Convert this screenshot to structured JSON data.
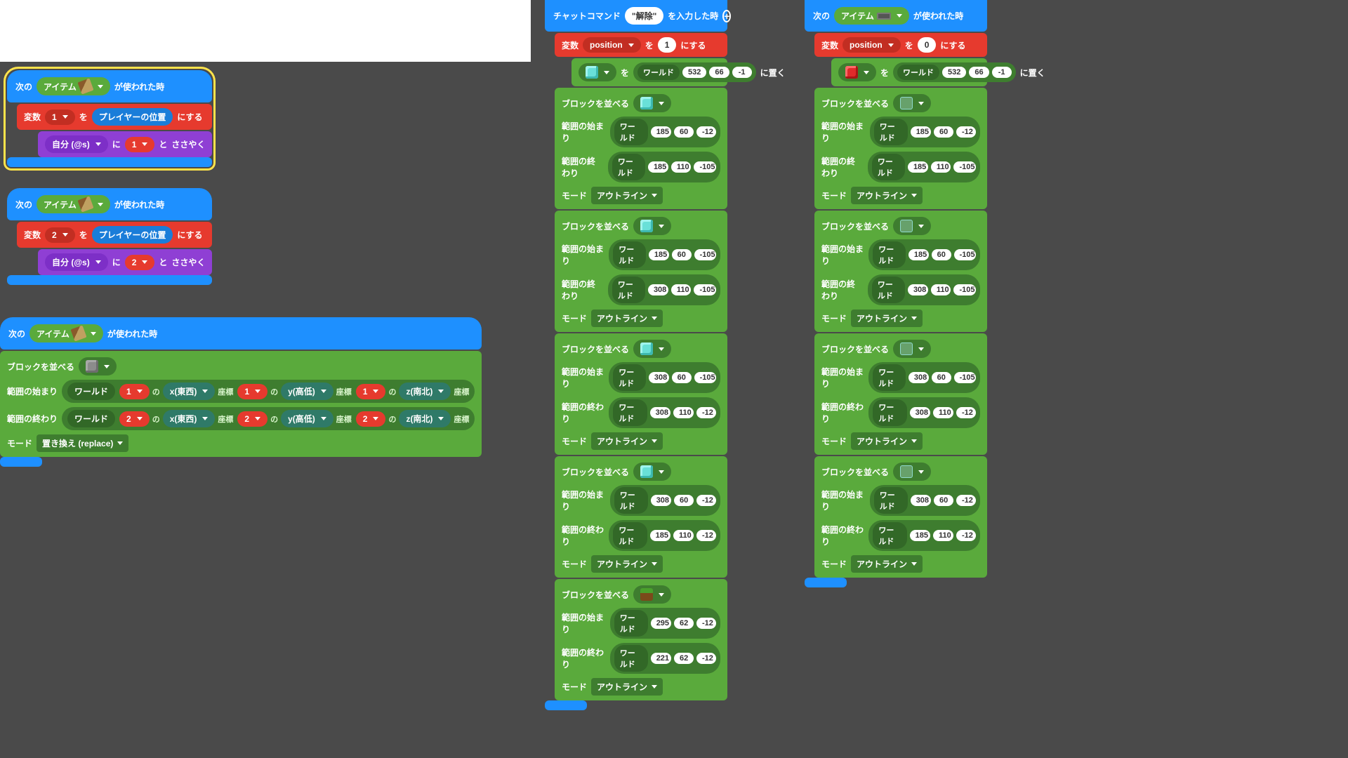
{
  "common": {
    "next": "次の",
    "item": "アイテム",
    "whenUsed": "が使われた時",
    "var": "変数",
    "to": "を",
    "set": "にする",
    "playerPos": "プレイヤーの位置",
    "self": "自分 (@s)",
    "ni": "に",
    "and": "と",
    "whisper": "ささやく",
    "place": "に置く",
    "fill": "ブロックを並べる",
    "from": "範囲の始まり",
    "toEnd": "範囲の終わり",
    "world": "ワールド",
    "mode": "モード",
    "outline": "アウトライン",
    "replace": "置き換え (replace)",
    "no": "の",
    "xLabel": "x(東西)",
    "yLabel": "y(高低)",
    "zLabel": "z(南北)",
    "coord": "座標",
    "chatCmd": "チャットコマンド",
    "chatVal": "\"解除\"",
    "chatSuffix": "を入力した時",
    "position": "position"
  },
  "nums": {
    "one": "1",
    "two": "2",
    "zero": "0"
  },
  "posA": [
    "532",
    "66",
    "-1"
  ],
  "col2": {
    "fills": [
      {
        "ico": "ico-diam",
        "from": [
          "185",
          "60",
          "-12"
        ],
        "to": [
          "185",
          "110",
          "-105"
        ],
        "mode": "outline"
      },
      {
        "ico": "ico-diam",
        "from": [
          "185",
          "60",
          "-105"
        ],
        "to": [
          "308",
          "110",
          "-105"
        ],
        "mode": "outline"
      },
      {
        "ico": "ico-diam",
        "from": [
          "308",
          "60",
          "-105"
        ],
        "to": [
          "308",
          "110",
          "-12"
        ],
        "mode": "outline"
      },
      {
        "ico": "ico-diam",
        "from": [
          "308",
          "60",
          "-12"
        ],
        "to": [
          "185",
          "110",
          "-12"
        ],
        "mode": "outline"
      },
      {
        "ico": "ico-grass",
        "from": [
          "295",
          "62",
          "-12"
        ],
        "to": [
          "221",
          "62",
          "-12"
        ],
        "mode": "outline"
      }
    ]
  },
  "col3": {
    "fills": [
      {
        "ico": "ico-glass",
        "from": [
          "185",
          "60",
          "-12"
        ],
        "to": [
          "185",
          "110",
          "-105"
        ],
        "mode": "outline"
      },
      {
        "ico": "ico-glass",
        "from": [
          "185",
          "60",
          "-105"
        ],
        "to": [
          "308",
          "110",
          "-105"
        ],
        "mode": "outline"
      },
      {
        "ico": "ico-glass",
        "from": [
          "308",
          "60",
          "-105"
        ],
        "to": [
          "308",
          "110",
          "-12"
        ],
        "mode": "outline"
      },
      {
        "ico": "ico-glass",
        "from": [
          "308",
          "60",
          "-12"
        ],
        "to": [
          "185",
          "110",
          "-12"
        ],
        "mode": "outline"
      }
    ]
  }
}
